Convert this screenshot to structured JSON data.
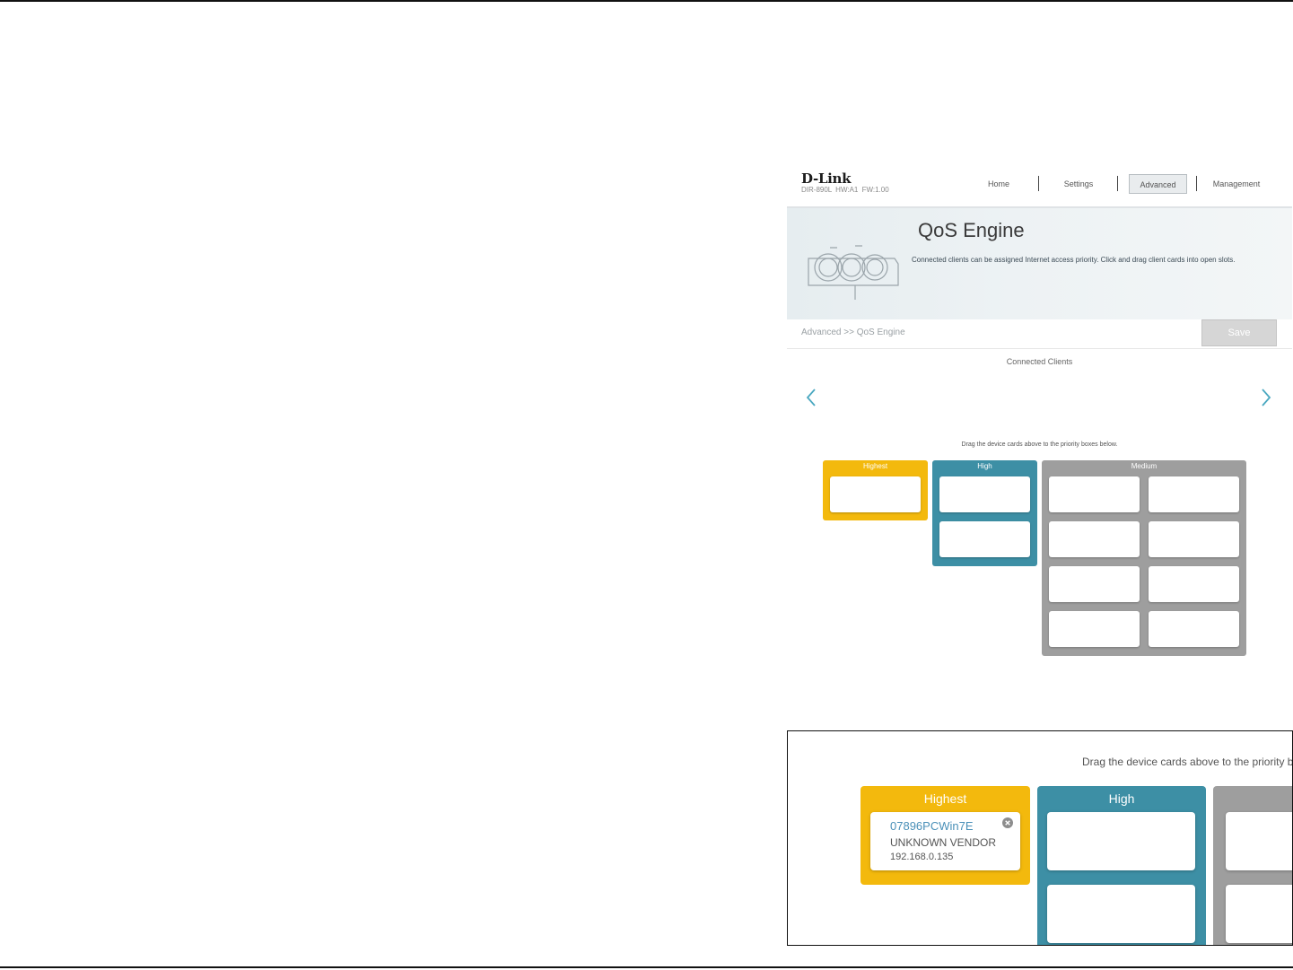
{
  "header": {
    "brand": "D-Link",
    "model": "DIR-890L  HW:A1  FW:1.00",
    "nav": [
      {
        "label": "Home"
      },
      {
        "label": "Settings"
      },
      {
        "label": "Advanced",
        "active": true
      },
      {
        "label": "Management"
      }
    ]
  },
  "banner": {
    "title": "QoS Engine",
    "description": "Connected clients can be assigned Internet access priority. Click and drag client cards into open slots."
  },
  "breadcrumb": "Advanced >> QoS Engine",
  "save_label": "Save",
  "connected_clients_label": "Connected Clients",
  "drag_hint": "Drag the device cards above to the priority boxes below.",
  "priority": {
    "highest": {
      "label": "Highest",
      "color": "#f3b90d"
    },
    "high": {
      "label": "High",
      "color": "#3d8fa5"
    },
    "medium": {
      "label": "Medium",
      "color": "#9e9e9e"
    }
  },
  "inset": {
    "hint": "Drag the device cards above to the priority box",
    "card": {
      "name": "07896PCWin7E",
      "vendor": "UNKNOWN VENDOR",
      "ip": "192.168.0.135"
    }
  },
  "colors": {
    "accent": "#4a90b8",
    "arrow": "#4aa8c0"
  }
}
